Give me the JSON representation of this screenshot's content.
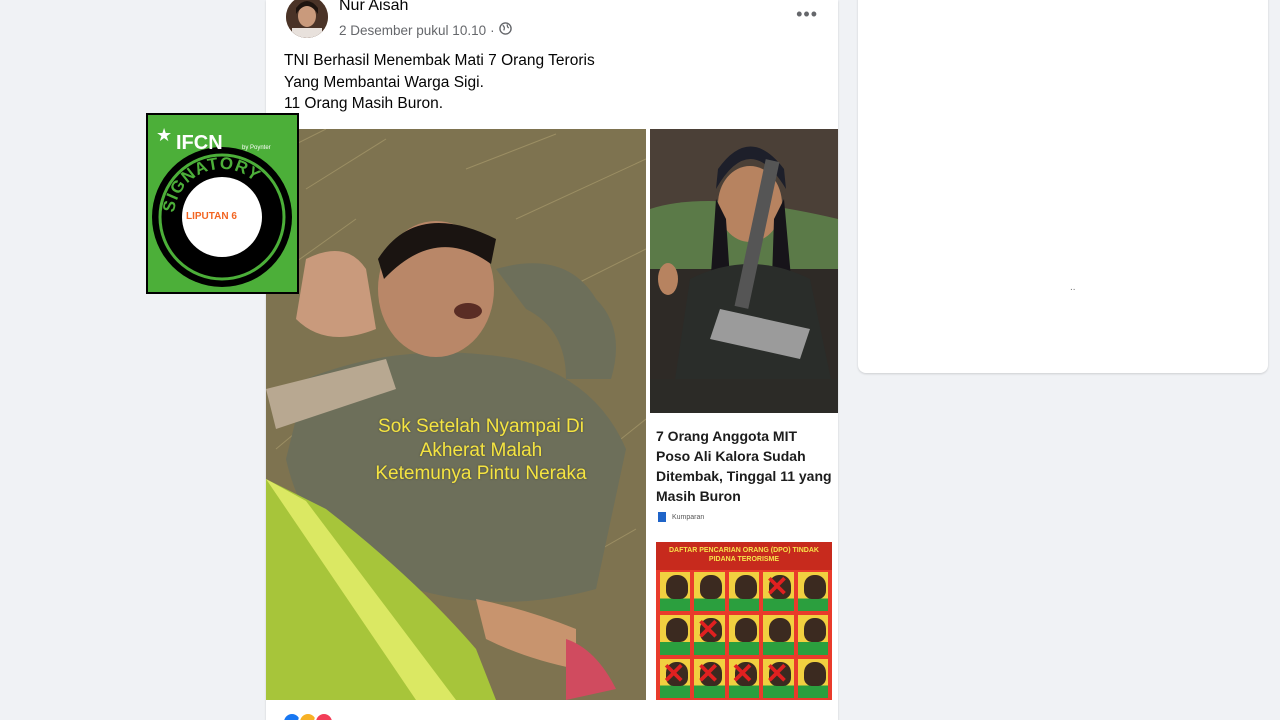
{
  "post": {
    "author": "Nur Aisah",
    "timestamp": "2 Desember pukul 10.10",
    "separator": "·",
    "privacy_icon": "globe-icon",
    "more_label": "•••",
    "caption_lines": [
      "TNI Berhasil Menembak Mati 7 Orang Teroris",
      "Yang Membantai Warga Sigi.",
      "11 Orang Masih Buron."
    ],
    "main_photo_overlay": [
      "Sok Setelah Nyampai Di",
      "Akherat Malah",
      "Ketemunya Pintu Neraka"
    ],
    "news_card": {
      "title": "7 Orang Anggota MIT Poso Ali Kalora Sudah Ditembak, Tinggal 11 yang Masih Buron",
      "source": "Kumparan",
      "poster_header": "DAFTAR PENCARIAN ORANG (DPO) TINDAK PIDANA TERORISME",
      "poster_crossed": [
        false,
        false,
        false,
        true,
        false,
        false,
        true,
        false,
        false,
        false,
        true,
        true,
        true,
        true,
        false
      ]
    }
  },
  "badge": {
    "ifcn_label": "IFCN",
    "ifcn_sub": "by Poynter",
    "ring_text": "SIGNATORY",
    "center_label": "LIPUTAN 6"
  },
  "side_card": {
    "loading_text": ".."
  },
  "colors": {
    "page_bg": "#f0f2f5",
    "card_bg": "#ffffff",
    "secondary_text": "#65676b",
    "overlay_yellow": "#f5e441",
    "ifcn_green": "#4caf39"
  }
}
